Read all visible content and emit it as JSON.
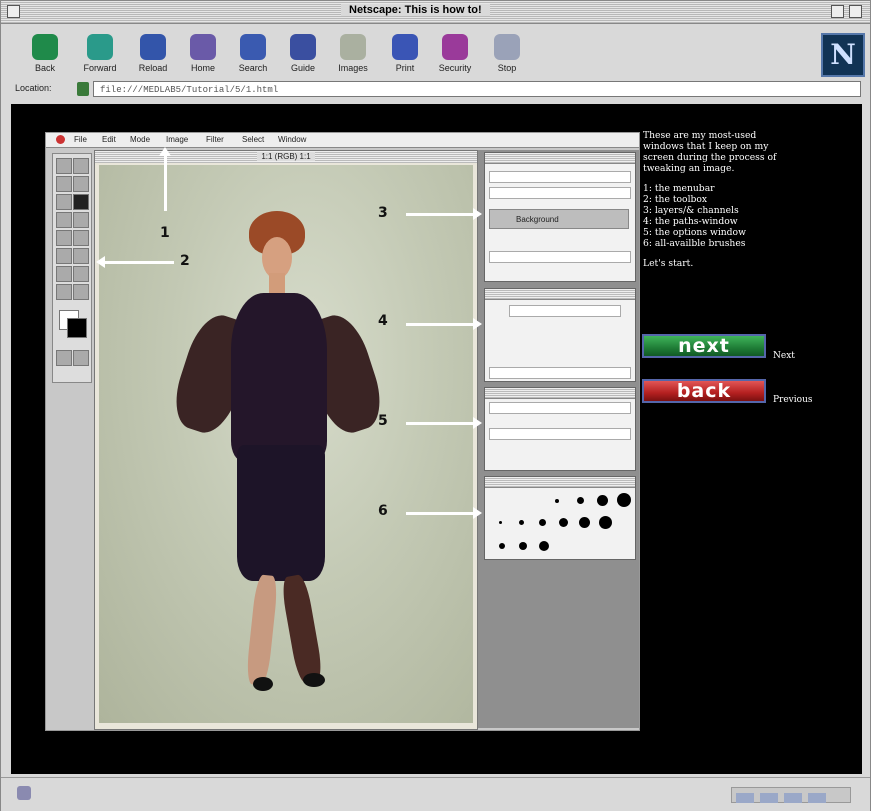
{
  "window": {
    "title": "Netscape: This is how to!"
  },
  "toolbar": {
    "buttons": [
      {
        "label": "Back",
        "color": "#1f8a4a"
      },
      {
        "label": "Forward",
        "color": "#2a9a8a"
      },
      {
        "label": "Reload",
        "color": "#3355aa"
      },
      {
        "label": "Home",
        "color": "#6a5aa8"
      },
      {
        "label": "Search",
        "color": "#3a5ab0"
      },
      {
        "label": "Guide",
        "color": "#3a4fa0"
      },
      {
        "label": "Images",
        "color": "#aab0a0"
      },
      {
        "label": "Print",
        "color": "#3a55b5"
      },
      {
        "label": "Security",
        "color": "#9a3a9a"
      },
      {
        "label": "Stop",
        "color": "#9aa2b8"
      }
    ],
    "logo": "N"
  },
  "location": {
    "label": "Location:",
    "url": "file:///MEDLAB5/Tutorial/5/1.html"
  },
  "photoshop": {
    "menu": [
      "File",
      "Edit",
      "Mode",
      "Image",
      "Filter",
      "Select",
      "Window"
    ],
    "image_title": "1:1 (RGB) 1:1",
    "layer_name": "Background",
    "callouts": [
      "1",
      "2",
      "3",
      "4",
      "5",
      "6"
    ]
  },
  "info": {
    "intro": "These are my most-used windows that I keep on my screen during the process of tweaking an image.",
    "items": [
      "1: the menubar",
      "2: the toolbox",
      "3: layers/& channels",
      "4: the paths-window",
      "5: the options window",
      "6: all-availble brushes"
    ],
    "outro": "Let's start."
  },
  "nav": {
    "next_label": "next",
    "next_caption": "Next",
    "back_label": "back",
    "back_caption": "Previous"
  }
}
